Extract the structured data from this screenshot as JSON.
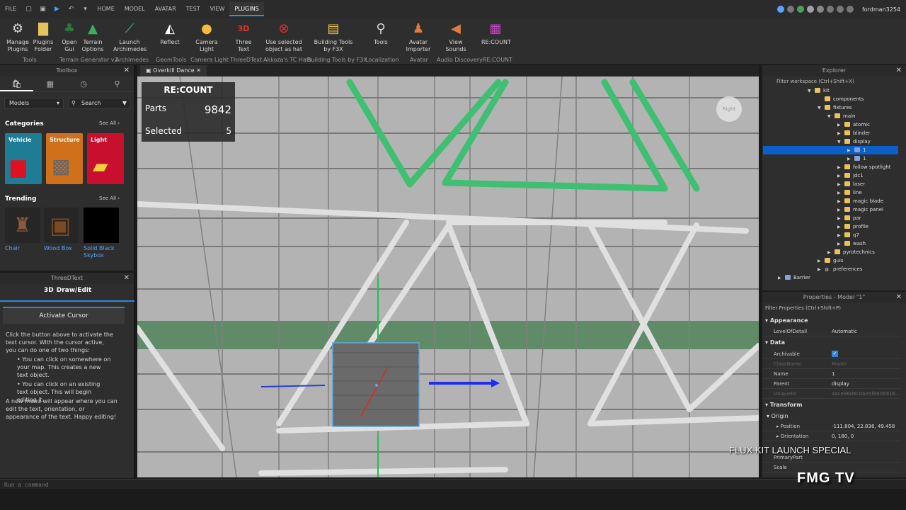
{
  "menubar": {
    "file": "FILE",
    "tabs": [
      "HOME",
      "MODEL",
      "AVATAR",
      "TEST",
      "VIEW",
      "PLUGINS"
    ],
    "active_tab": "PLUGINS",
    "username": "fordman3254"
  },
  "ribbon": {
    "buttons": [
      {
        "label": "Manage\nPlugins",
        "icon": "manage-plugins-icon"
      },
      {
        "label": "Plugins\nFolder",
        "icon": "folder-icon"
      },
      {
        "label": "Open\nGui",
        "icon": "open-gui-icon"
      },
      {
        "label": "Terrain\nOptions",
        "icon": "terrain-icon"
      },
      {
        "label": "Launch\nArchimedes",
        "icon": "archimedes-icon"
      },
      {
        "label": "Reflect",
        "icon": "reflect-icon"
      },
      {
        "label": "Camera\nLight",
        "icon": "camera-light-icon"
      },
      {
        "label": "Three\nText",
        "icon": "three-text-icon"
      },
      {
        "label": "Use selected\nobject as hat",
        "icon": "hat-icon"
      },
      {
        "label": "Building Tools\nby F3X",
        "icon": "f3x-icon"
      },
      {
        "label": "Tools",
        "icon": "tools-icon"
      },
      {
        "label": "Avatar\nImporter",
        "icon": "avatar-importer-icon"
      },
      {
        "label": "View\nSounds",
        "icon": "sound-icon"
      },
      {
        "label": "RE:COUNT",
        "icon": "recount-icon"
      }
    ],
    "groups": [
      "Tools",
      "Terrain Generator v2",
      "Archimedes",
      "GeomTools",
      "Camera Light",
      "ThreeDText",
      "Akkoza's TC Hats",
      "Building Tools by F3X",
      "Localization",
      "Avatar",
      "Audio Discovery",
      "RE:COUNT"
    ]
  },
  "toolbox": {
    "title": "Toolbox",
    "category_select": "Models",
    "search_placeholder": "Search",
    "categories_heading": "Categories",
    "see_all": "See All",
    "categories": [
      "Vehicle",
      "Structure",
      "Light"
    ],
    "trending_heading": "Trending",
    "trending": [
      "Chair",
      "Wood Box",
      "Solid Black\nSkybox"
    ]
  },
  "threedtext": {
    "title": "ThreeDText",
    "mode": "Draw/Edit",
    "button": "Activate Cursor",
    "desc1": "Click the button above to activate the text cursor. With the cursor active, you can do one of two things:",
    "bullet1": "• You can click on somewhere on your map. This creates a new text object.",
    "bullet2": "• You can click on an existing text object. This will begin editing it.",
    "desc2": "A new menu will appear where you can edit the text, orientation, or appearance of the text. Happy editing!"
  },
  "viewport": {
    "tab": "Overkill Dance",
    "view_label": "Right",
    "recount": {
      "title": "RE:COUNT",
      "parts_label": "Parts",
      "parts": "9842",
      "selected_label": "Selected",
      "selected": "5"
    }
  },
  "explorer": {
    "title": "Explorer",
    "filter": "Filter workspace (Ctrl+Shift+X)",
    "tree": [
      {
        "name": "kit",
        "depth": 4,
        "open": true
      },
      {
        "name": "components",
        "depth": 5,
        "open": false,
        "noarrow": true
      },
      {
        "name": "fixtures",
        "depth": 5,
        "open": true
      },
      {
        "name": "main",
        "depth": 6,
        "open": true
      },
      {
        "name": "atomic",
        "depth": 7,
        "open": false
      },
      {
        "name": "blinder",
        "depth": 7,
        "open": false
      },
      {
        "name": "display",
        "depth": 7,
        "open": true
      },
      {
        "name": "1",
        "depth": 8,
        "open": false,
        "selected": true,
        "model": true
      },
      {
        "name": "1",
        "depth": 8,
        "open": false,
        "model": true
      },
      {
        "name": "follow spotlight",
        "depth": 7,
        "open": false
      },
      {
        "name": "jdc1",
        "depth": 7,
        "open": false
      },
      {
        "name": "laser",
        "depth": 7,
        "open": false
      },
      {
        "name": "line",
        "depth": 7,
        "open": false
      },
      {
        "name": "magic blade",
        "depth": 7,
        "open": false
      },
      {
        "name": "magic panel",
        "depth": 7,
        "open": false
      },
      {
        "name": "par",
        "depth": 7,
        "open": false
      },
      {
        "name": "profile",
        "depth": 7,
        "open": false
      },
      {
        "name": "q7",
        "depth": 7,
        "open": false
      },
      {
        "name": "wash",
        "depth": 7,
        "open": false
      },
      {
        "name": "pyrotechnics",
        "depth": 6,
        "open": false
      },
      {
        "name": "guis",
        "depth": 5,
        "open": false
      },
      {
        "name": "preferences",
        "depth": 5,
        "open": false,
        "gear": true
      },
      {
        "name": "Barrier",
        "depth": 1,
        "open": false,
        "model": true
      }
    ]
  },
  "properties": {
    "title": "Properties - Model \"1\"",
    "filter": "Filter Properties (Ctrl+Shift+P)",
    "sections": {
      "appearance": "Appearance",
      "data": "Data",
      "transform": "Transform",
      "origin": "Origin"
    },
    "rows": {
      "levelofdetail": {
        "name": "LevelOfDetail",
        "value": "Automatic"
      },
      "archivable": {
        "name": "Archivable",
        "value": ""
      },
      "classname": {
        "name": "ClassName",
        "value": "Model"
      },
      "name": {
        "name": "Name",
        "value": "1"
      },
      "parent": {
        "name": "Parent",
        "value": "display"
      },
      "uniqueid": {
        "name": "UniqueId",
        "value": "4ace96d6c04e5f8806916..."
      },
      "position": {
        "name": "Position",
        "value": "-111.804, 22.836, 49.458"
      },
      "orientation": {
        "name": "Orientation",
        "value": "0, 180, 0"
      },
      "primarypart": {
        "name": "PrimaryPart",
        "value": ""
      },
      "scale": {
        "name": "Scale",
        "value": ""
      }
    }
  },
  "command": {
    "placeholder": "Run a command"
  },
  "overlay": {
    "watermark": "FLUX KIT LAUNCH SPECIAL",
    "logo": "FMG TV"
  }
}
